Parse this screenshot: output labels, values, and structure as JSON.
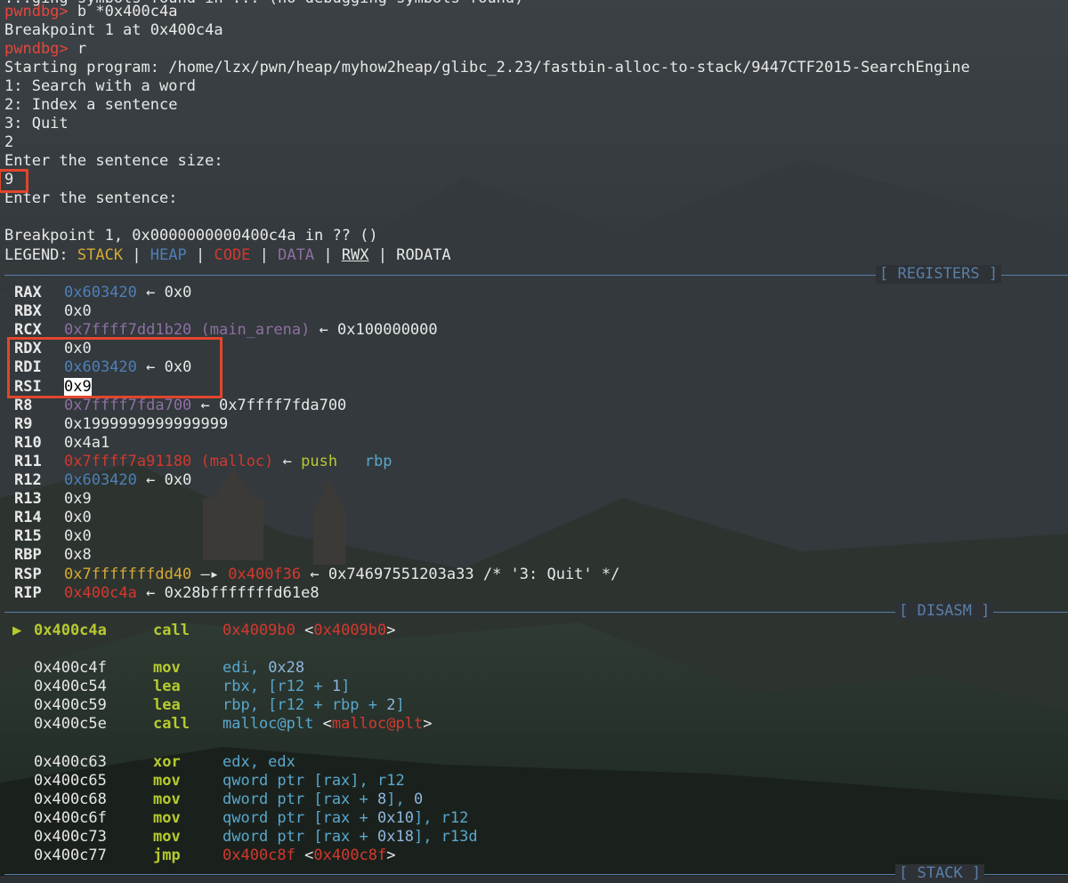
{
  "session": [
    {
      "prompt": "",
      "text": "...ging symbols found in ... (no debugging symbols found)"
    },
    {
      "prompt": "pwndbg> ",
      "text": "b *0x400c4a"
    },
    {
      "prompt": "",
      "text": "Breakpoint 1 at 0x400c4a"
    },
    {
      "prompt": "pwndbg> ",
      "text": "r"
    },
    {
      "prompt": "",
      "text": "Starting program: /home/lzx/pwn/heap/myhow2heap/glibc_2.23/fastbin-alloc-to-stack/9447CTF2015-SearchEngine"
    },
    {
      "prompt": "",
      "text": "1: Search with a word"
    },
    {
      "prompt": "",
      "text": "2: Index a sentence"
    },
    {
      "prompt": "",
      "text": "3: Quit"
    },
    {
      "prompt": "",
      "text": "2"
    },
    {
      "prompt": "",
      "text": "Enter the sentence size:"
    },
    {
      "prompt": "",
      "text": "9"
    },
    {
      "prompt": "",
      "text": "Enter the sentence:"
    },
    {
      "prompt": "",
      "text": ""
    },
    {
      "prompt": "",
      "text": "Breakpoint 1, 0x0000000000400c4a in ?? ()"
    }
  ],
  "legend": {
    "label": "LEGEND: ",
    "stack": "STACK",
    "heap": "HEAP",
    "code": "CODE",
    "data": "DATA",
    "rwx": "RWX",
    "rodata": "RODATA",
    "bar": " | "
  },
  "sections": {
    "registers": "[ REGISTERS ]",
    "disasm": "[ DISASM ]",
    "stack": "[ STACK ]"
  },
  "registers": [
    {
      "name": "RAX",
      "parts": [
        {
          "t": "0x603420",
          "c": "heap"
        },
        {
          "t": " ← 0x0",
          "c": ""
        }
      ]
    },
    {
      "name": "RBX",
      "parts": [
        {
          "t": "0x0",
          "c": ""
        }
      ]
    },
    {
      "name": "RCX",
      "parts": [
        {
          "t": "0x7ffff7dd1b20 (main_arena)",
          "c": "data"
        },
        {
          "t": " ← 0x100000000",
          "c": ""
        }
      ]
    },
    {
      "name": "RDX",
      "parts": [
        {
          "t": "0x0",
          "c": ""
        }
      ]
    },
    {
      "name": "RDI",
      "parts": [
        {
          "t": "0x603420",
          "c": "heap"
        },
        {
          "t": " ← 0x0",
          "c": ""
        }
      ]
    },
    {
      "name": "RSI",
      "parts": [
        {
          "t": "0x9",
          "c": "inv"
        }
      ]
    },
    {
      "name": "R8",
      "parts": [
        {
          "t": "0x7ffff7fda700",
          "c": "data"
        },
        {
          "t": " ← 0x7ffff7fda700",
          "c": ""
        }
      ]
    },
    {
      "name": "R9",
      "parts": [
        {
          "t": "0x1999999999999999",
          "c": ""
        }
      ]
    },
    {
      "name": "R10",
      "parts": [
        {
          "t": "0x4a1",
          "c": ""
        }
      ]
    },
    {
      "name": "R11",
      "parts": [
        {
          "t": "0x7ffff7a91180 (malloc)",
          "c": "code"
        },
        {
          "t": " ← ",
          "c": ""
        },
        {
          "t": "push",
          "c": "mnem"
        },
        {
          "t": "   rbp",
          "c": "regname"
        }
      ]
    },
    {
      "name": "R12",
      "parts": [
        {
          "t": "0x603420",
          "c": "heap"
        },
        {
          "t": " ← 0x0",
          "c": ""
        }
      ]
    },
    {
      "name": "R13",
      "parts": [
        {
          "t": "0x9",
          "c": ""
        }
      ]
    },
    {
      "name": "R14",
      "parts": [
        {
          "t": "0x0",
          "c": ""
        }
      ]
    },
    {
      "name": "R15",
      "parts": [
        {
          "t": "0x0",
          "c": ""
        }
      ]
    },
    {
      "name": "RBP",
      "parts": [
        {
          "t": "0x8",
          "c": ""
        }
      ]
    },
    {
      "name": "RSP",
      "parts": [
        {
          "t": "0x7fffffffdd40",
          "c": "stack"
        },
        {
          "t": " —▸ ",
          "c": ""
        },
        {
          "t": "0x400f36",
          "c": "code"
        },
        {
          "t": " ← 0x74697551203a33 /* '3: Quit' */",
          "c": ""
        }
      ]
    },
    {
      "name": "RIP",
      "parts": [
        {
          "t": "0x400c4a",
          "c": "code"
        },
        {
          "t": " ← 0x28bfffffffd61e8",
          "c": ""
        }
      ]
    }
  ],
  "disasm": [
    {
      "addr": "0x400c4a",
      "op": "call",
      "args": [
        {
          "t": "0x4009b0",
          "c": "num"
        },
        {
          "t": " <",
          "c": "plain"
        },
        {
          "t": "0x4009b0",
          "c": "num"
        },
        {
          "t": ">",
          "c": "plain"
        }
      ],
      "current": true,
      "gap": false
    },
    {
      "addr": "0x400c4f",
      "op": "mov",
      "args": [
        {
          "t": "edi, ",
          "c": ""
        },
        {
          "t": "0x28",
          "c": "sym"
        }
      ],
      "current": false,
      "gap": true
    },
    {
      "addr": "0x400c54",
      "op": "lea",
      "args": [
        {
          "t": "rbx, [r12 + ",
          "c": ""
        },
        {
          "t": "1",
          "c": "sym"
        },
        {
          "t": "]",
          "c": ""
        }
      ],
      "current": false,
      "gap": false
    },
    {
      "addr": "0x400c59",
      "op": "lea",
      "args": [
        {
          "t": "rbp, [r12 + rbp + ",
          "c": ""
        },
        {
          "t": "2",
          "c": "sym"
        },
        {
          "t": "]",
          "c": ""
        }
      ],
      "current": false,
      "gap": false
    },
    {
      "addr": "0x400c5e",
      "op": "call",
      "args": [
        {
          "t": "malloc@plt",
          "c": ""
        },
        {
          "t": " <",
          "c": "plain"
        },
        {
          "t": "malloc@plt",
          "c": "num"
        },
        {
          "t": ">",
          "c": "plain"
        }
      ],
      "current": false,
      "gap": false
    },
    {
      "addr": "0x400c63",
      "op": "xor",
      "args": [
        {
          "t": "edx, edx",
          "c": ""
        }
      ],
      "current": false,
      "gap": true
    },
    {
      "addr": "0x400c65",
      "op": "mov",
      "args": [
        {
          "t": "qword ptr [rax], r12",
          "c": ""
        }
      ],
      "current": false,
      "gap": false
    },
    {
      "addr": "0x400c68",
      "op": "mov",
      "args": [
        {
          "t": "dword ptr [rax + ",
          "c": ""
        },
        {
          "t": "8",
          "c": "sym"
        },
        {
          "t": "], ",
          "c": ""
        },
        {
          "t": "0",
          "c": "sym"
        }
      ],
      "current": false,
      "gap": false
    },
    {
      "addr": "0x400c6f",
      "op": "mov",
      "args": [
        {
          "t": "qword ptr [rax + ",
          "c": ""
        },
        {
          "t": "0x10",
          "c": "sym"
        },
        {
          "t": "], r12",
          "c": ""
        }
      ],
      "current": false,
      "gap": false
    },
    {
      "addr": "0x400c73",
      "op": "mov",
      "args": [
        {
          "t": "dword ptr [rax + ",
          "c": ""
        },
        {
          "t": "0x18",
          "c": "sym"
        },
        {
          "t": "], r13d",
          "c": ""
        }
      ],
      "current": false,
      "gap": false
    },
    {
      "addr": "0x400c77",
      "op": "jmp",
      "args": [
        {
          "t": "0x400c8f",
          "c": "num"
        },
        {
          "t": " <",
          "c": "plain"
        },
        {
          "t": "0x400c8f",
          "c": "num"
        },
        {
          "t": ">",
          "c": "plain"
        }
      ],
      "current": false,
      "gap": false
    }
  ],
  "colors": {
    "prompt": "#e8453c",
    "highlight_box": "#e2462c",
    "separator": "#5a7ea8",
    "mnemonic": "#b7ca2e",
    "register": "#5aa7cc"
  },
  "icons": {
    "current_instruction": "play-triangle-icon",
    "background": "mountain-church-landscape"
  }
}
